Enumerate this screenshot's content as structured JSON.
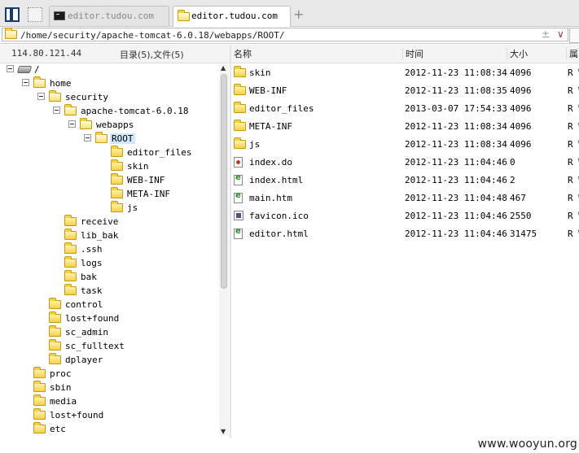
{
  "tabs": [
    {
      "label": "editor.tudou.com",
      "icon": "terminal-icon",
      "active": false
    },
    {
      "label": "editor.tudou.com",
      "icon": "folder-icon",
      "active": true
    }
  ],
  "new_tab_label": "+",
  "address": {
    "path": "/home/security/apache-tomcat-6.0.18/webapps/ROOT/",
    "pm_glyph": "±",
    "dropdown_glyph": "∨"
  },
  "left_panel": {
    "host": "114.80.121.44",
    "summary": "目录(5),文件(5)"
  },
  "tree": [
    {
      "label": "/",
      "icon": "drive-icon",
      "indent": 0,
      "toggle": true
    },
    {
      "label": "home",
      "icon": "folder-icon",
      "indent": 1,
      "toggle": true
    },
    {
      "label": "security",
      "icon": "folder-icon",
      "indent": 2,
      "toggle": true
    },
    {
      "label": "apache-tomcat-6.0.18",
      "icon": "folder-icon",
      "indent": 3,
      "toggle": true
    },
    {
      "label": "webapps",
      "icon": "folder-icon",
      "indent": 4,
      "toggle": true
    },
    {
      "label": "ROOT",
      "icon": "folder-icon",
      "indent": 5,
      "toggle": true,
      "selected": true
    },
    {
      "label": "editor_files",
      "icon": "folder-icon",
      "indent": 6
    },
    {
      "label": "skin",
      "icon": "folder-icon",
      "indent": 6
    },
    {
      "label": "WEB-INF",
      "icon": "folder-icon",
      "indent": 6
    },
    {
      "label": "META-INF",
      "icon": "folder-icon",
      "indent": 6
    },
    {
      "label": "js",
      "icon": "folder-icon",
      "indent": 6
    },
    {
      "label": "receive",
      "icon": "folder-icon",
      "indent": 3
    },
    {
      "label": "lib_bak",
      "icon": "folder-icon",
      "indent": 3
    },
    {
      "label": ".ssh",
      "icon": "folder-icon",
      "indent": 3
    },
    {
      "label": "logs",
      "icon": "folder-icon",
      "indent": 3
    },
    {
      "label": "bak",
      "icon": "folder-icon",
      "indent": 3
    },
    {
      "label": "task",
      "icon": "folder-icon",
      "indent": 3
    },
    {
      "label": "control",
      "icon": "folder-icon",
      "indent": 2
    },
    {
      "label": "lost+found",
      "icon": "folder-icon",
      "indent": 2
    },
    {
      "label": "sc_admin",
      "icon": "folder-icon",
      "indent": 2
    },
    {
      "label": "sc_fulltext",
      "icon": "folder-icon",
      "indent": 2
    },
    {
      "label": "dplayer",
      "icon": "folder-icon",
      "indent": 2
    },
    {
      "label": "proc",
      "icon": "folder-icon",
      "indent": 1
    },
    {
      "label": "sbin",
      "icon": "folder-icon",
      "indent": 1
    },
    {
      "label": "media",
      "icon": "folder-icon",
      "indent": 1
    },
    {
      "label": "lost+found",
      "icon": "folder-icon",
      "indent": 1
    },
    {
      "label": "etc",
      "icon": "folder-icon",
      "indent": 1
    }
  ],
  "scroll": {
    "up": "▲",
    "down": "▼"
  },
  "file_columns": {
    "name": "名称",
    "time": "时间",
    "size": "大小",
    "attr": "属"
  },
  "files": [
    {
      "name": "skin",
      "time": "2012-11-23 11:08:34",
      "size": "4096",
      "attr": "R W",
      "icon": "folder-icon"
    },
    {
      "name": "WEB-INF",
      "time": "2012-11-23 11:08:35",
      "size": "4096",
      "attr": "R W",
      "icon": "folder-icon"
    },
    {
      "name": "editor_files",
      "time": "2013-03-07 17:54:33",
      "size": "4096",
      "attr": "R W",
      "icon": "folder-icon"
    },
    {
      "name": "META-INF",
      "time": "2012-11-23 11:08:34",
      "size": "4096",
      "attr": "R W",
      "icon": "folder-icon"
    },
    {
      "name": "js",
      "time": "2012-11-23 11:08:34",
      "size": "4096",
      "attr": "R W",
      "icon": "folder-icon"
    },
    {
      "name": "index.do",
      "time": "2012-11-23 11:04:46",
      "size": "0",
      "attr": "R W",
      "icon": "do-file-icon"
    },
    {
      "name": "index.html",
      "time": "2012-11-23 11:04:46",
      "size": "2",
      "attr": "R W",
      "icon": "html-file-icon"
    },
    {
      "name": "main.htm",
      "time": "2012-11-23 11:04:48",
      "size": "467",
      "attr": "R W",
      "icon": "html-file-icon"
    },
    {
      "name": "favicon.ico",
      "time": "2012-11-23 11:04:46",
      "size": "2550",
      "attr": "R W",
      "icon": "ico-file-icon"
    },
    {
      "name": "editor.html",
      "time": "2012-11-23 11:04:46",
      "size": "31475",
      "attr": "R W",
      "icon": "html-file-icon"
    }
  ],
  "watermark": "www.wooyun.org"
}
